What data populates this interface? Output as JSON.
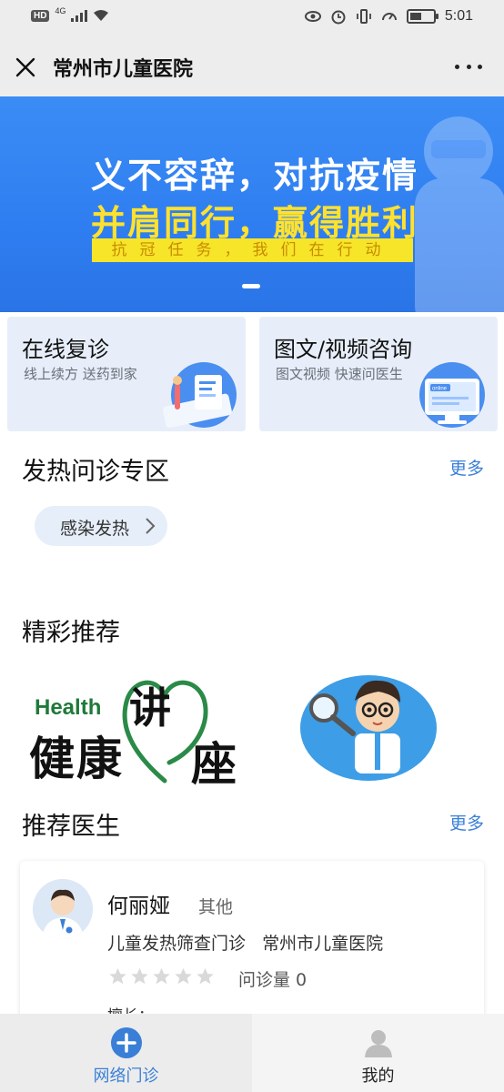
{
  "status_bar": {
    "hd": "HD",
    "network": "4G",
    "time": "5:01"
  },
  "nav": {
    "title": "常州市儿童医院",
    "close_icon": "close-icon",
    "more_icon": "more-dots-icon"
  },
  "banner": {
    "line1": "义不容辞，对抗疫情",
    "line2": "并肩同行，赢得胜利",
    "strip": "抗冠任务，我们在行动",
    "line2_color": "#ffe12e"
  },
  "services": [
    {
      "title": "在线复诊",
      "subtitle": "线上续方 送药到家",
      "icon": "prescription-illustration"
    },
    {
      "title": "图文/视频咨询",
      "subtitle": "图文视频 快速问医生",
      "icon": "online-monitor-illustration",
      "badge": "online"
    }
  ],
  "fever": {
    "title": "发热问诊专区",
    "more": "更多",
    "chip": "感染发热"
  },
  "recommend": {
    "title": "精彩推荐",
    "health_logo": {
      "en": "Health",
      "left": "健康",
      "middle": "讲",
      "right": "座"
    }
  },
  "doctors": {
    "title": "推荐医生",
    "more": "更多",
    "items": [
      {
        "name": "何丽娅",
        "title": "其他",
        "department": "儿童发热筛查门诊",
        "hospital": "常州市儿童医院",
        "rating": 0,
        "consult": "问诊量 0",
        "expertise": "擅长："
      }
    ]
  },
  "tabs": [
    {
      "label": "网络门诊",
      "icon": "plus-circle-icon",
      "active": true
    },
    {
      "label": "我的",
      "icon": "user-icon",
      "active": false
    }
  ],
  "colors": {
    "accent": "#3a7fd7",
    "banner": "#2f7ef1",
    "card_bg": "#e7eef9"
  }
}
